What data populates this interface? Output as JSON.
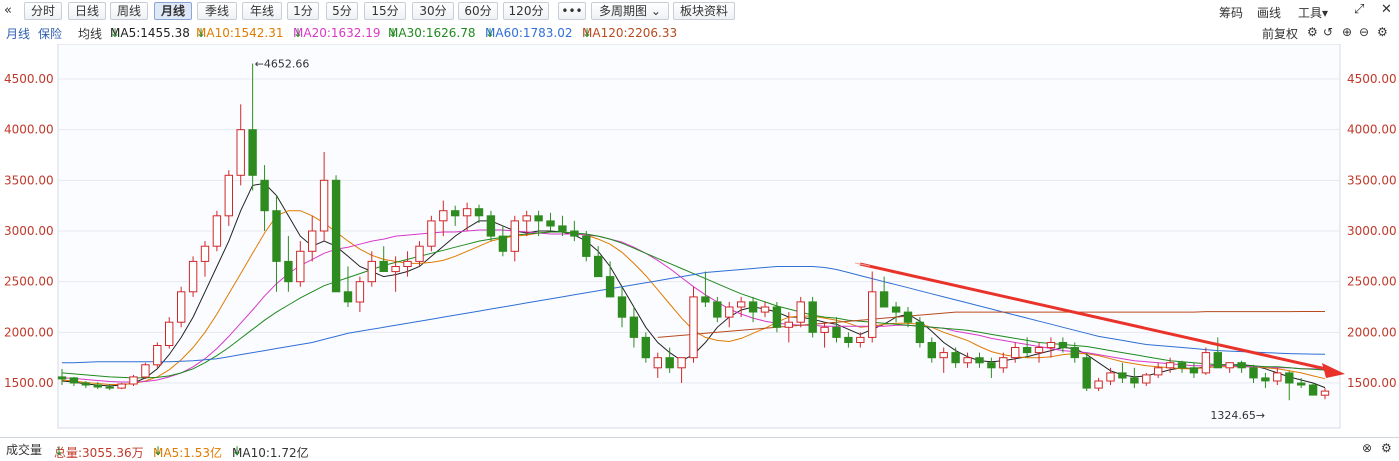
{
  "toolbar": {
    "back_icon": "collapse-left-icon",
    "periods": [
      "分时",
      "日线",
      "周线",
      "月线",
      "季线",
      "年线",
      "1分",
      "5分",
      "15分",
      "30分",
      "60分",
      "120分"
    ],
    "active_period": "月线",
    "more_label": "•••",
    "multi_period_label": "多周期图",
    "sector_label": "板块资料",
    "right_items": [
      "筹码",
      "画线",
      "工具"
    ],
    "expand_icon": "fullscreen-icon",
    "close_icon": "close-icon"
  },
  "ma_bar": {
    "period_label": "月线",
    "insurance_label": "保险",
    "avg_label": "均线",
    "ma5": "MA5:1455.38",
    "ma10": "MA10:1542.31",
    "ma20": "MA20:1632.19",
    "ma30": "MA30:1626.78",
    "ma60": "MA60:1783.02",
    "ma120": "MA120:2206.33",
    "arrow": "↓",
    "adjust_label": "前复权",
    "colors": {
      "ma5": "#222222",
      "ma10": "#e07b00",
      "ma20": "#d838c8",
      "ma30": "#1e8a1e",
      "ma60": "#2f6fd6",
      "ma120": "#b84a1e"
    }
  },
  "axis": {
    "ticks": [
      "4500.00",
      "4000.00",
      "3500.00",
      "3000.00",
      "2500.00",
      "2000.00",
      "1500.00"
    ],
    "tick_values": [
      4500,
      4000,
      3500,
      3000,
      2500,
      2000,
      1500
    ],
    "left_color": "#c0392b",
    "right_color": "#c0392b"
  },
  "annotations": {
    "high_label": "4652.66",
    "low_label": "1324.65"
  },
  "volume_bar": {
    "label": "成交量",
    "total": "总量:3055.36万",
    "ma5": "MA5:1.53亿",
    "ma10": "MA10:1.72亿",
    "arrow": "↓"
  },
  "chart_data": {
    "type": "candlestick",
    "ylim": [
      1200,
      4750
    ],
    "candles": [
      [
        1560,
        1640,
        1480,
        1540
      ],
      [
        1550,
        1560,
        1470,
        1500
      ],
      [
        1500,
        1520,
        1450,
        1480
      ],
      [
        1480,
        1510,
        1440,
        1460
      ],
      [
        1460,
        1490,
        1430,
        1450
      ],
      [
        1450,
        1500,
        1440,
        1490
      ],
      [
        1490,
        1580,
        1470,
        1560
      ],
      [
        1560,
        1700,
        1540,
        1680
      ],
      [
        1680,
        1900,
        1650,
        1870
      ],
      [
        1870,
        2150,
        1840,
        2100
      ],
      [
        2100,
        2450,
        2050,
        2400
      ],
      [
        2400,
        2750,
        2350,
        2700
      ],
      [
        2700,
        2900,
        2550,
        2850
      ],
      [
        2850,
        3200,
        2800,
        3150
      ],
      [
        3150,
        3600,
        3050,
        3550
      ],
      [
        3550,
        4250,
        3450,
        4000
      ],
      [
        4000,
        4652.66,
        3400,
        3550
      ],
      [
        3500,
        3650,
        3000,
        3200
      ],
      [
        3200,
        3350,
        2400,
        2700
      ],
      [
        2700,
        2950,
        2400,
        2500
      ],
      [
        2500,
        2900,
        2450,
        2800
      ],
      [
        2800,
        3150,
        2700,
        3000
      ],
      [
        3000,
        3780,
        2900,
        3500
      ],
      [
        3500,
        3550,
        2500,
        2400
      ],
      [
        2400,
        2650,
        2250,
        2300
      ],
      [
        2300,
        2550,
        2200,
        2500
      ],
      [
        2500,
        2800,
        2450,
        2700
      ],
      [
        2700,
        2850,
        2600,
        2600
      ],
      [
        2600,
        2750,
        2400,
        2650
      ],
      [
        2650,
        2800,
        2550,
        2700
      ],
      [
        2700,
        2900,
        2650,
        2850
      ],
      [
        2850,
        3150,
        2800,
        3100
      ],
      [
        3100,
        3300,
        2950,
        3200
      ],
      [
        3200,
        3250,
        3050,
        3150
      ],
      [
        3150,
        3280,
        3000,
        3220
      ],
      [
        3220,
        3260,
        3080,
        3150
      ],
      [
        3150,
        3200,
        2900,
        2950
      ],
      [
        2950,
        3050,
        2750,
        2800
      ],
      [
        2800,
        3150,
        2700,
        3100
      ],
      [
        3100,
        3200,
        2950,
        3150
      ],
      [
        3150,
        3200,
        2950,
        3100
      ],
      [
        3100,
        3180,
        3000,
        3050
      ],
      [
        3050,
        3150,
        2950,
        3000
      ],
      [
        3000,
        3100,
        2900,
        2950
      ],
      [
        2950,
        3000,
        2700,
        2750
      ],
      [
        2750,
        2850,
        2550,
        2550
      ],
      [
        2550,
        2700,
        2350,
        2350
      ],
      [
        2350,
        2450,
        2050,
        2150
      ],
      [
        2150,
        2250,
        1850,
        1950
      ],
      [
        1950,
        2000,
        1700,
        1750
      ],
      [
        1650,
        1800,
        1550,
        1750
      ],
      [
        1750,
        1850,
        1600,
        1650
      ],
      [
        1650,
        1750,
        1500,
        1750
      ],
      [
        1750,
        2450,
        1700,
        2350
      ],
      [
        2350,
        2600,
        2250,
        2300
      ],
      [
        2300,
        2350,
        2100,
        2150
      ],
      [
        2150,
        2300,
        2050,
        2250
      ],
      [
        2250,
        2350,
        2150,
        2300
      ],
      [
        2300,
        2350,
        2100,
        2200
      ],
      [
        2200,
        2300,
        2150,
        2250
      ],
      [
        2250,
        2300,
        2000,
        2050
      ],
      [
        2050,
        2200,
        1900,
        2100
      ],
      [
        2100,
        2350,
        2050,
        2300
      ],
      [
        2300,
        2350,
        1950,
        2000
      ],
      [
        2000,
        2100,
        1850,
        2050
      ],
      [
        2050,
        2150,
        1900,
        1950
      ],
      [
        1950,
        2000,
        1850,
        1900
      ],
      [
        1900,
        2000,
        1850,
        1950
      ],
      [
        1950,
        2600,
        1900,
        2400
      ],
      [
        2400,
        2550,
        2250,
        2250
      ],
      [
        2250,
        2300,
        2100,
        2200
      ],
      [
        2200,
        2250,
        2050,
        2100
      ],
      [
        2100,
        2150,
        1850,
        1900
      ],
      [
        1900,
        1950,
        1700,
        1750
      ],
      [
        1750,
        1850,
        1600,
        1800
      ],
      [
        1800,
        1850,
        1650,
        1700
      ],
      [
        1700,
        1800,
        1650,
        1750
      ],
      [
        1750,
        1800,
        1650,
        1700
      ],
      [
        1700,
        1750,
        1550,
        1650
      ],
      [
        1650,
        1800,
        1600,
        1750
      ],
      [
        1750,
        1900,
        1700,
        1850
      ],
      [
        1850,
        1950,
        1750,
        1800
      ],
      [
        1800,
        1900,
        1700,
        1850
      ],
      [
        1850,
        1950,
        1750,
        1900
      ],
      [
        1900,
        1950,
        1800,
        1850
      ],
      [
        1850,
        1900,
        1700,
        1750
      ],
      [
        1750,
        1800,
        1420,
        1450
      ],
      [
        1450,
        1550,
        1420,
        1520
      ],
      [
        1520,
        1650,
        1480,
        1600
      ],
      [
        1600,
        1700,
        1500,
        1550
      ],
      [
        1550,
        1650,
        1450,
        1500
      ],
      [
        1500,
        1600,
        1470,
        1580
      ],
      [
        1580,
        1700,
        1550,
        1650
      ],
      [
        1650,
        1750,
        1600,
        1700
      ],
      [
        1700,
        1720,
        1600,
        1650
      ],
      [
        1650,
        1700,
        1550,
        1600
      ],
      [
        1600,
        1850,
        1580,
        1800
      ],
      [
        1800,
        1950,
        1750,
        1650
      ],
      [
        1650,
        1700,
        1600,
        1700
      ],
      [
        1700,
        1720,
        1600,
        1650
      ],
      [
        1650,
        1680,
        1500,
        1550
      ],
      [
        1550,
        1600,
        1450,
        1520
      ],
      [
        1520,
        1650,
        1480,
        1600
      ],
      [
        1600,
        1620,
        1330,
        1500
      ],
      [
        1500,
        1550,
        1450,
        1480
      ],
      [
        1480,
        1500,
        1380,
        1380
      ],
      [
        1380,
        1450,
        1340,
        1420
      ]
    ],
    "ma_lines": {
      "MA5": [
        1520,
        1510,
        1490,
        1480,
        1470,
        1480,
        1500,
        1550,
        1640,
        1780,
        1950,
        2150,
        2400,
        2650,
        2900,
        3200,
        3450,
        3470,
        3350,
        3150,
        2950,
        2850,
        2900,
        2850,
        2750,
        2650,
        2600,
        2550,
        2570,
        2600,
        2650,
        2750,
        2850,
        2950,
        3030,
        3100,
        3100,
        3050,
        3000,
        2980,
        3000,
        3000,
        2990,
        2960,
        2900,
        2800,
        2650,
        2450,
        2250,
        2050,
        1900,
        1800,
        1720,
        1780,
        1900,
        2050,
        2150,
        2220,
        2250,
        2230,
        2200,
        2150,
        2150,
        2130,
        2100,
        2080,
        2030,
        1980,
        2030,
        2080,
        2150,
        2180,
        2110,
        2010,
        1900,
        1820,
        1760,
        1720,
        1710,
        1720,
        1740,
        1760,
        1790,
        1820,
        1850,
        1840,
        1780,
        1700,
        1620,
        1580,
        1560,
        1570,
        1600,
        1630,
        1650,
        1640,
        1660,
        1680,
        1680,
        1680,
        1670,
        1640,
        1600,
        1560,
        1530,
        1500,
        1455
      ],
      "MA10": [
        1530,
        1520,
        1505,
        1495,
        1485,
        1485,
        1495,
        1520,
        1560,
        1630,
        1730,
        1850,
        2000,
        2180,
        2380,
        2580,
        2780,
        2980,
        3150,
        3200,
        3200,
        3150,
        3080,
        2990,
        2900,
        2820,
        2760,
        2720,
        2700,
        2680,
        2680,
        2690,
        2710,
        2750,
        2800,
        2850,
        2900,
        2930,
        2950,
        2960,
        2980,
        2990,
        2990,
        2980,
        2960,
        2920,
        2870,
        2790,
        2680,
        2560,
        2420,
        2280,
        2140,
        2020,
        1950,
        1920,
        1910,
        1940,
        1990,
        2040,
        2100,
        2150,
        2160,
        2160,
        2140,
        2120,
        2090,
        2050,
        2060,
        2080,
        2090,
        2090,
        2080,
        2050,
        2000,
        1960,
        1920,
        1860,
        1810,
        1780,
        1760,
        1750,
        1750,
        1760,
        1780,
        1790,
        1790,
        1770,
        1740,
        1710,
        1690,
        1670,
        1660,
        1650,
        1640,
        1640,
        1650,
        1660,
        1660,
        1660,
        1660,
        1650,
        1640,
        1620,
        1600,
        1570,
        1542
      ],
      "MA20": [
        1550,
        1545,
        1535,
        1525,
        1515,
        1510,
        1510,
        1515,
        1530,
        1560,
        1600,
        1660,
        1740,
        1840,
        1960,
        2090,
        2220,
        2360,
        2480,
        2580,
        2660,
        2720,
        2780,
        2820,
        2840,
        2870,
        2900,
        2920,
        2950,
        2960,
        2970,
        2980,
        2990,
        2990,
        3000,
        3010,
        3010,
        3010,
        3000,
        2990,
        2980,
        2970,
        2970,
        2970,
        2960,
        2950,
        2920,
        2890,
        2840,
        2780,
        2710,
        2630,
        2540,
        2450,
        2370,
        2300,
        2230,
        2180,
        2140,
        2110,
        2090,
        2080,
        2070,
        2070,
        2060,
        2060,
        2060,
        2060,
        2060,
        2060,
        2070,
        2070,
        2060,
        2050,
        2040,
        2010,
        1990,
        1970,
        1940,
        1920,
        1900,
        1880,
        1860,
        1840,
        1820,
        1810,
        1800,
        1780,
        1760,
        1740,
        1720,
        1710,
        1700,
        1690,
        1680,
        1670,
        1670,
        1670,
        1670,
        1660,
        1660,
        1660,
        1650,
        1650,
        1640,
        1640,
        1632
      ],
      "MA30": [
        1600,
        1590,
        1580,
        1570,
        1560,
        1555,
        1550,
        1550,
        1555,
        1570,
        1600,
        1640,
        1700,
        1770,
        1850,
        1940,
        2030,
        2120,
        2200,
        2270,
        2340,
        2400,
        2460,
        2500,
        2540,
        2580,
        2620,
        2660,
        2690,
        2720,
        2750,
        2780,
        2810,
        2840,
        2870,
        2900,
        2920,
        2940,
        2960,
        2970,
        2980,
        2990,
        2990,
        2980,
        2970,
        2950,
        2920,
        2880,
        2830,
        2780,
        2730,
        2680,
        2630,
        2580,
        2530,
        2480,
        2430,
        2380,
        2340,
        2300,
        2260,
        2230,
        2200,
        2170,
        2150,
        2140,
        2120,
        2110,
        2100,
        2090,
        2080,
        2070,
        2060,
        2050,
        2040,
        2030,
        2020,
        2000,
        1980,
        1960,
        1940,
        1920,
        1900,
        1890,
        1880,
        1870,
        1860,
        1840,
        1820,
        1800,
        1780,
        1760,
        1740,
        1720,
        1710,
        1700,
        1690,
        1680,
        1680,
        1670,
        1670,
        1660,
        1660,
        1650,
        1640,
        1635,
        1627
      ],
      "MA60": [
        1700,
        1700,
        1705,
        1710,
        1710,
        1710,
        1710,
        1710,
        1710,
        1710,
        1715,
        1720,
        1730,
        1740,
        1760,
        1780,
        1800,
        1820,
        1840,
        1860,
        1880,
        1900,
        1930,
        1960,
        1990,
        2010,
        2030,
        2050,
        2070,
        2090,
        2110,
        2130,
        2150,
        2170,
        2190,
        2210,
        2230,
        2250,
        2270,
        2290,
        2310,
        2330,
        2350,
        2370,
        2390,
        2410,
        2430,
        2450,
        2470,
        2490,
        2510,
        2530,
        2550,
        2570,
        2590,
        2600,
        2610,
        2620,
        2630,
        2640,
        2650,
        2650,
        2650,
        2650,
        2640,
        2620,
        2590,
        2560,
        2530,
        2500,
        2470,
        2440,
        2410,
        2380,
        2350,
        2320,
        2290,
        2260,
        2230,
        2200,
        2170,
        2140,
        2110,
        2080,
        2050,
        2020,
        1990,
        1960,
        1940,
        1920,
        1900,
        1880,
        1870,
        1860,
        1850,
        1840,
        1830,
        1820,
        1815,
        1810,
        1805,
        1800,
        1795,
        1790,
        1787,
        1785,
        1783
      ],
      "MA120": [
        null,
        null,
        null,
        null,
        null,
        null,
        null,
        null,
        null,
        null,
        null,
        null,
        null,
        null,
        null,
        null,
        null,
        null,
        null,
        null,
        null,
        null,
        null,
        null,
        null,
        null,
        null,
        null,
        null,
        null,
        null,
        null,
        null,
        null,
        null,
        null,
        null,
        null,
        null,
        null,
        null,
        null,
        null,
        null,
        null,
        null,
        null,
        null,
        null,
        null,
        1950,
        1960,
        1970,
        1980,
        1990,
        2000,
        2010,
        2020,
        2030,
        2040,
        2050,
        2060,
        2070,
        2080,
        2090,
        2100,
        2110,
        2120,
        2130,
        2140,
        2150,
        2160,
        2170,
        2180,
        2190,
        2200,
        2200,
        2200,
        2200,
        2200,
        2200,
        2200,
        2200,
        2200,
        2200,
        2200,
        2200,
        2200,
        2200,
        2200,
        2200,
        2200,
        2200,
        2200,
        2200,
        2200,
        2205,
        2205,
        2205,
        2205,
        2205,
        2205,
        2205,
        2205,
        2206,
        2206,
        2206
      ]
    }
  }
}
